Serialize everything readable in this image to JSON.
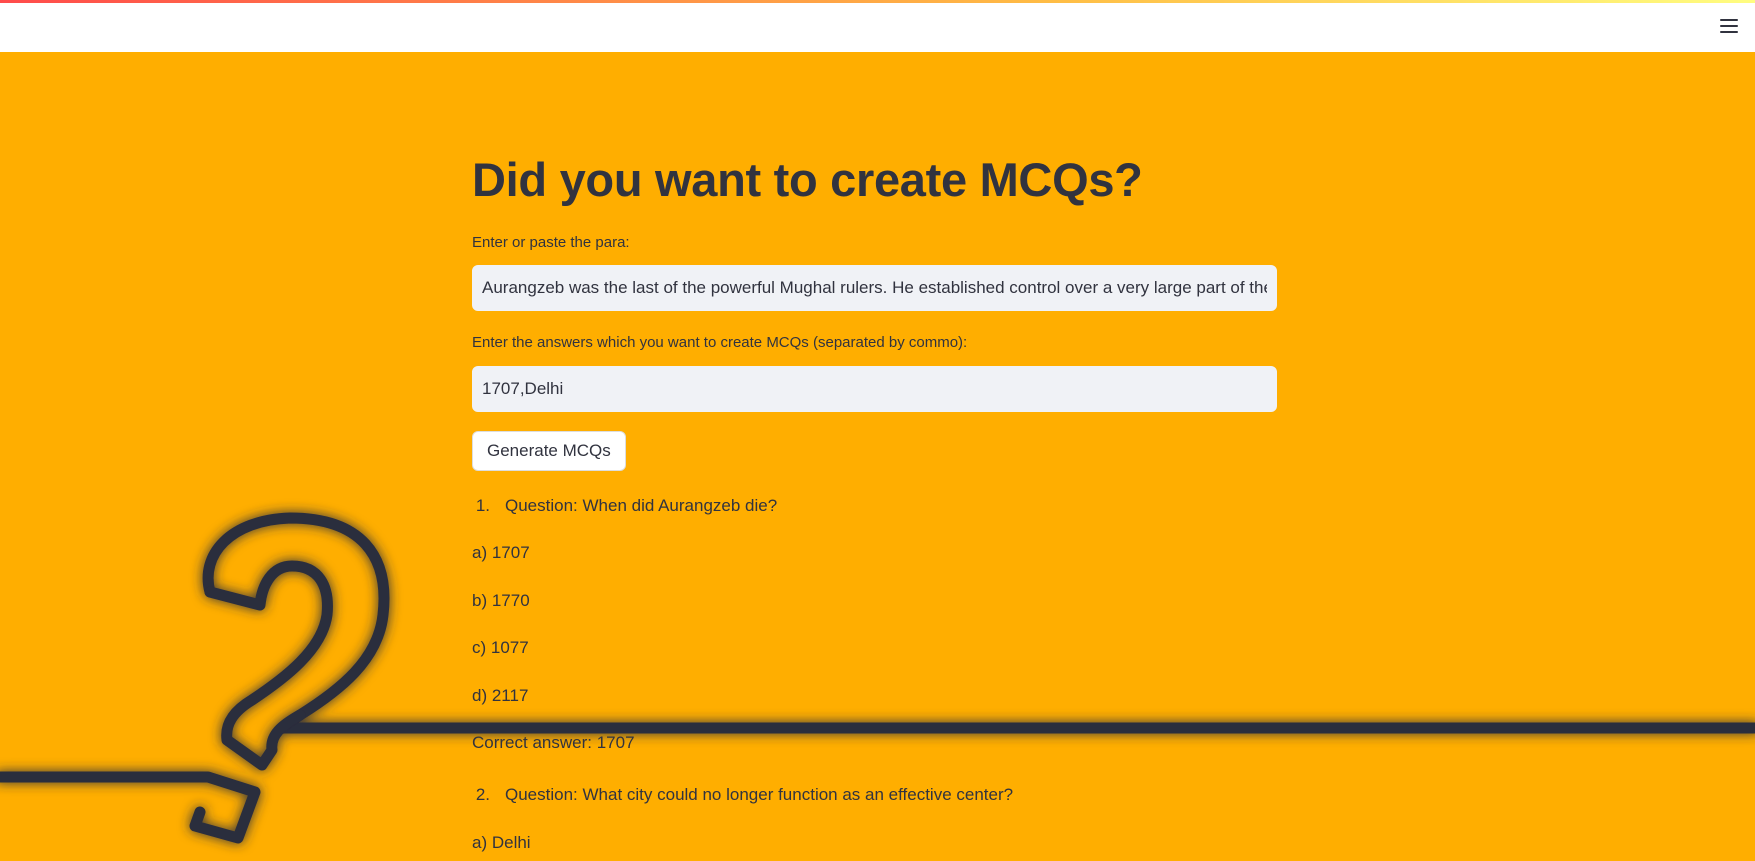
{
  "header": {
    "menu_icon": "hamburger-menu-icon"
  },
  "main": {
    "title": "Did you want to create MCQs?",
    "para_label": "Enter or paste the para:",
    "para_value": "Aurangzeb was the last of the powerful Mughal rulers. He established control over a very large part of the",
    "answers_label": "Enter the answers which you want to create MCQs (separated by commo):",
    "answers_value": "1707,Delhi",
    "generate_label": "Generate MCQs"
  },
  "questions": [
    {
      "number": "1.",
      "text": "Question: When did Aurangzeb die?",
      "options": [
        "a) 1707",
        "b) 1770",
        "c) 1077",
        "d) 2117"
      ],
      "correct": "Correct answer: 1707"
    },
    {
      "number": "2.",
      "text": "Question: What city could no longer function as an effective center?",
      "options": [
        "a) Delhi"
      ]
    }
  ],
  "colors": {
    "background": "#FFAE00",
    "text": "#31333f",
    "input_bg": "#f0f2f6",
    "art_stroke": "#2b2d3c"
  }
}
